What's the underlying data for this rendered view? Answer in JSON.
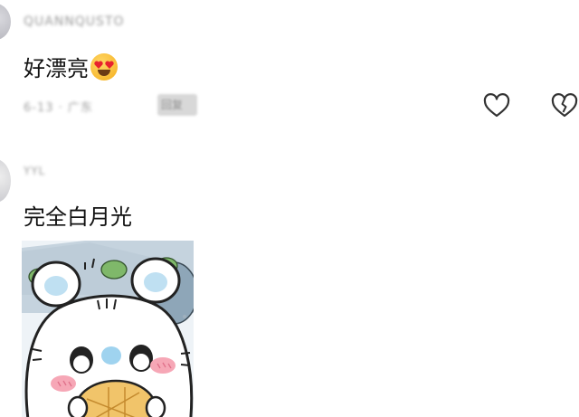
{
  "comments": [
    {
      "username": "QUANNQUSTO",
      "text": "好漂亮",
      "emoji": "smiling-face-with-heart-eyes",
      "meta": "6-13 · 广东",
      "reply_label": "回复"
    },
    {
      "username": "YYL",
      "text": "完全白月光",
      "image": "hamster-cartoon-sticker"
    }
  ],
  "actions": {
    "like_icon": "heart-outline-icon",
    "dislike_icon": "broken-heart-icon"
  },
  "colors": {
    "text": "#111111",
    "muted": "#9a9a9a",
    "icon": "#333333"
  }
}
